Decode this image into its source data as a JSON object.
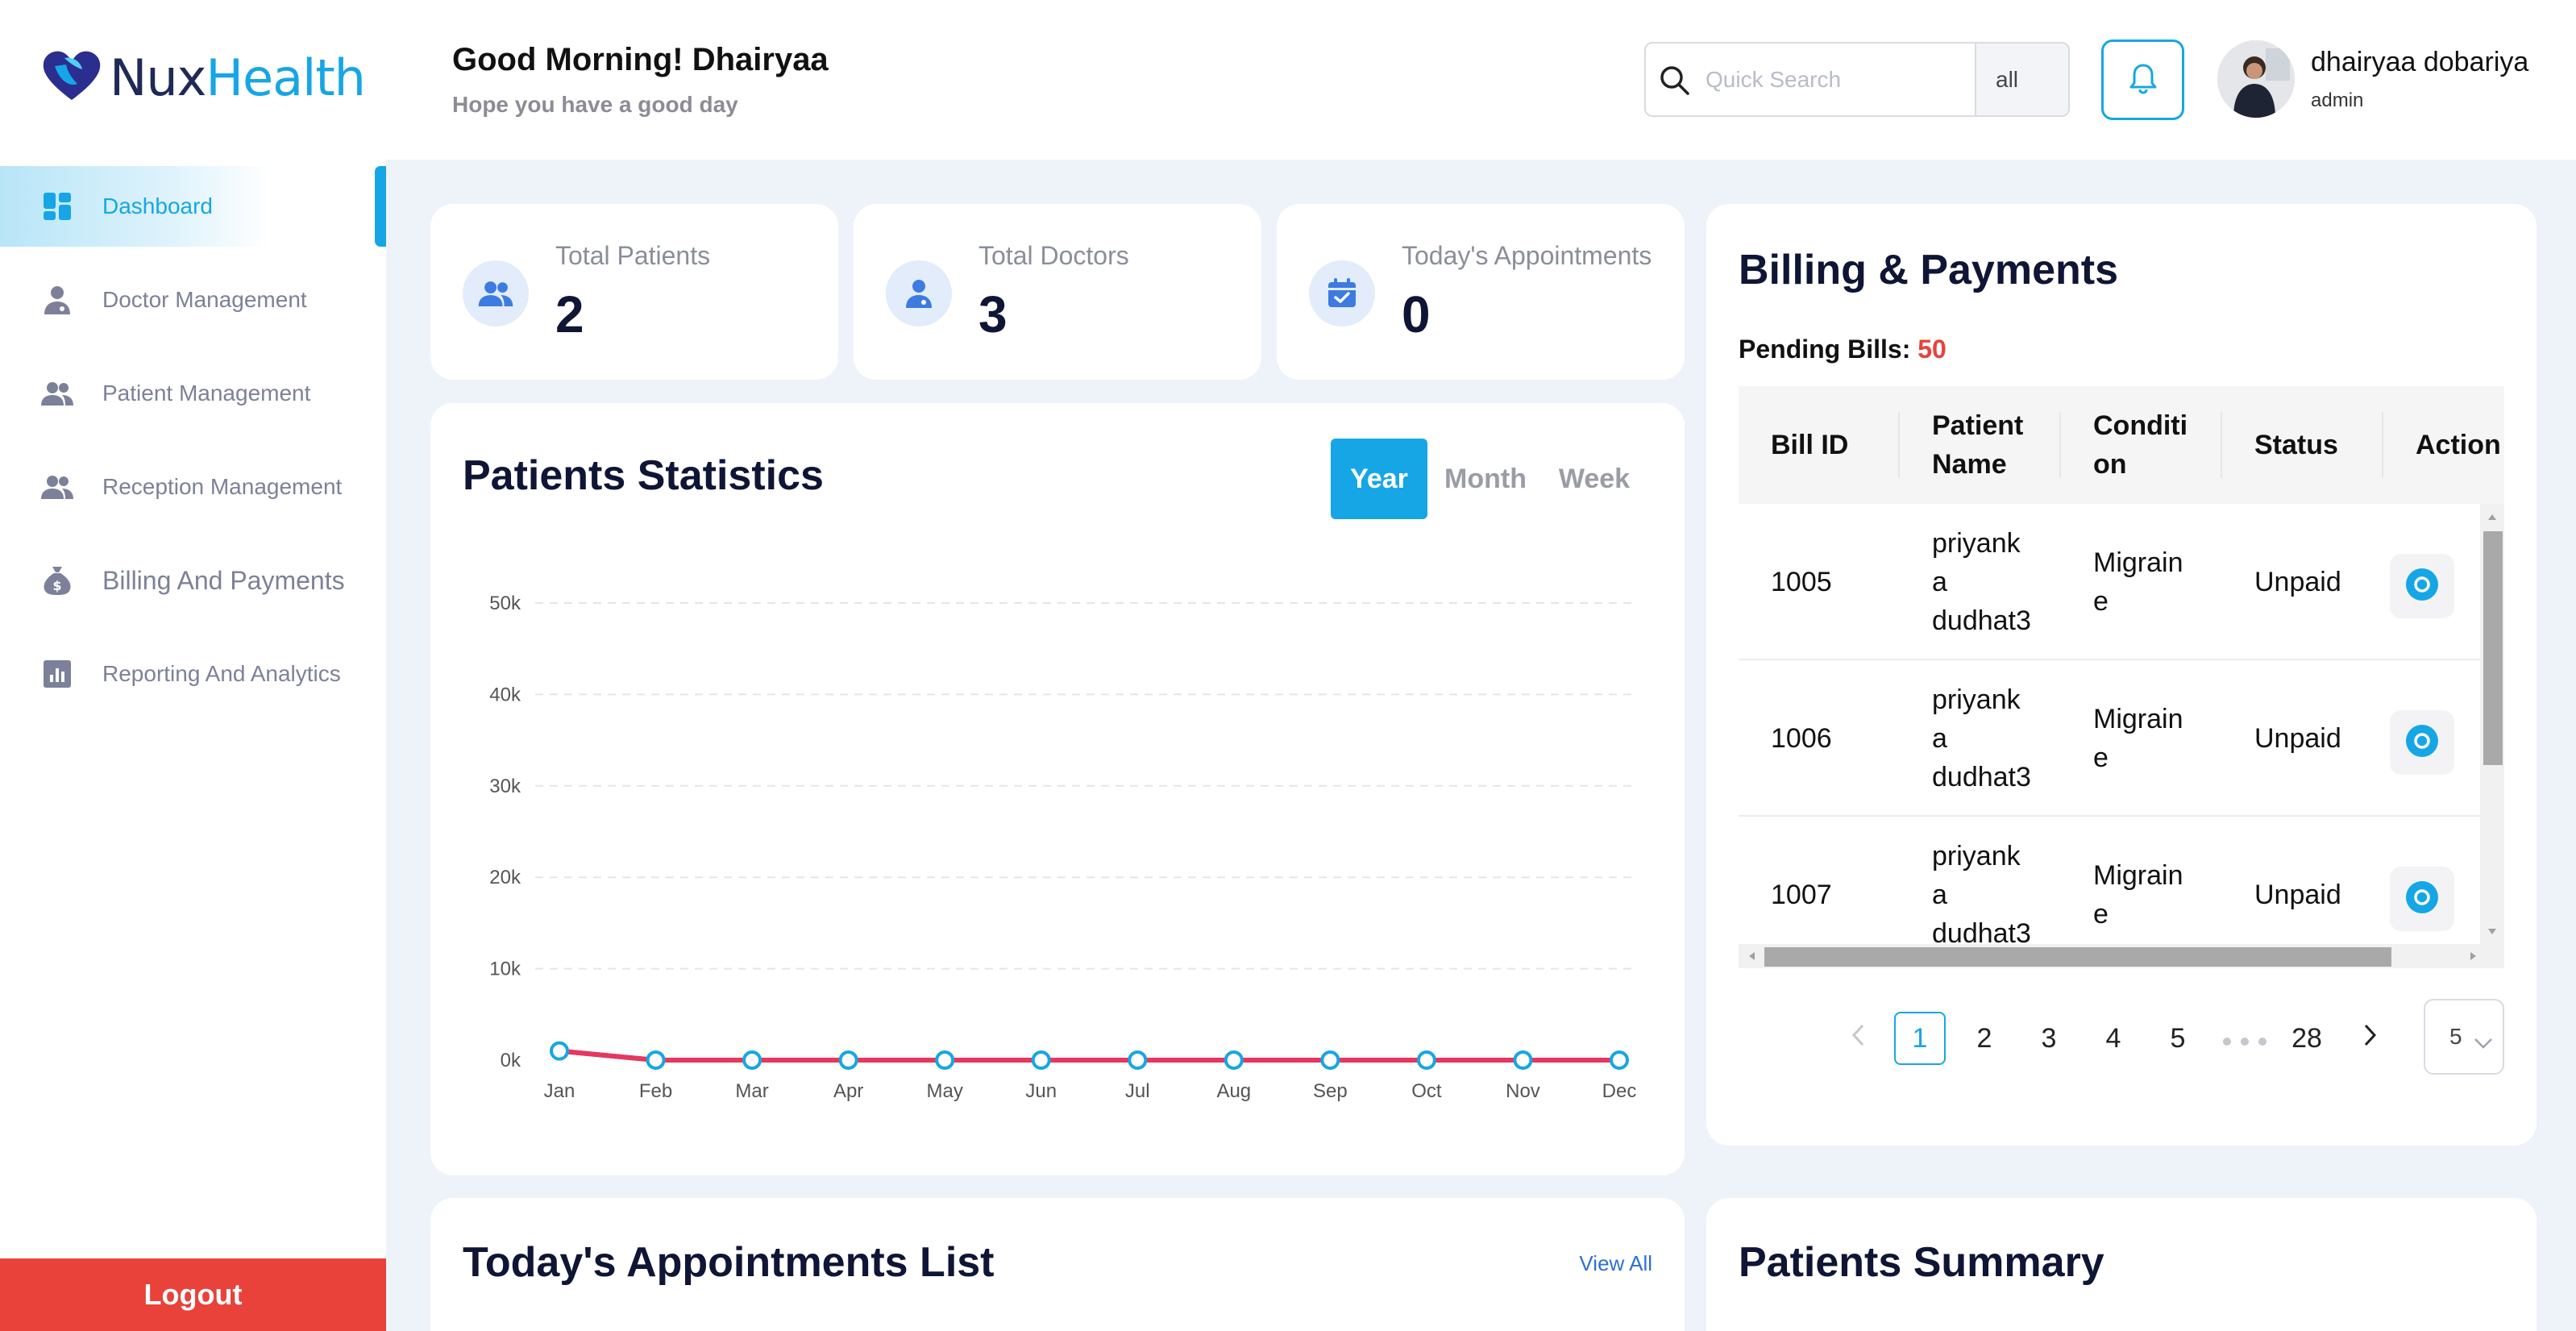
{
  "brand": {
    "part1": "Nux",
    "part2": "Health"
  },
  "sidebar": {
    "items": [
      {
        "label": "Dashboard",
        "icon": "dashboard-icon",
        "active": true
      },
      {
        "label": "Doctor Management",
        "icon": "doctor-icon"
      },
      {
        "label": "Patient Management",
        "icon": "patients-icon"
      },
      {
        "label": "Reception Management",
        "icon": "reception-icon"
      },
      {
        "label": "Billing And Payments",
        "icon": "money-bag-icon"
      },
      {
        "label": "Reporting And Analytics",
        "icon": "analytics-icon"
      }
    ],
    "logout_label": "Logout"
  },
  "header": {
    "greeting": "Good Morning! Dhairyaa",
    "subtitle": "Hope you have a good day",
    "search_placeholder": "Quick Search",
    "search_filter": "all",
    "user_name": "dhairyaa dobariya",
    "user_role": "admin"
  },
  "stats": [
    {
      "label": "Total Patients",
      "value": "2",
      "icon": "patients-icon"
    },
    {
      "label": "Total Doctors",
      "value": "3",
      "icon": "doctor-icon"
    },
    {
      "label": "Today's Appointments",
      "value": "0",
      "icon": "calendar-check-icon"
    }
  ],
  "statistics": {
    "title": "Patients Statistics",
    "periods": [
      "Year",
      "Month",
      "Week"
    ],
    "active_period": "Year"
  },
  "chart_data": {
    "type": "line",
    "categories": [
      "Jan",
      "Feb",
      "Mar",
      "Apr",
      "May",
      "Jun",
      "Jul",
      "Aug",
      "Sep",
      "Oct",
      "Nov",
      "Dec"
    ],
    "series": [
      {
        "values": [
          1000,
          0,
          0,
          0,
          0,
          0,
          0,
          0,
          0,
          0,
          0,
          0
        ],
        "color": "#e8365d"
      },
      {
        "values": [
          1000,
          0,
          0,
          0,
          0,
          0,
          0,
          0,
          0,
          0,
          0,
          0
        ],
        "color": "#4a6fd8"
      }
    ],
    "y_ticks": [
      "0k",
      "10k",
      "20k",
      "30k",
      "40k",
      "50k"
    ],
    "ylim": [
      0,
      50000
    ],
    "grid": true,
    "marker_color": "#16a6e6"
  },
  "billing": {
    "title": "Billing & Payments",
    "pending_label": "Pending Bills:",
    "pending_count": "50",
    "columns": [
      "Bill ID",
      "Patient Name",
      "Conditi on",
      "Status",
      "Action"
    ],
    "rows": [
      {
        "bill_id": "1005",
        "patient": "priyank a dudhat3",
        "condition": "Migrain e",
        "status": "Unpaid"
      },
      {
        "bill_id": "1006",
        "patient": "priyank a dudhat3",
        "condition": "Migrain e",
        "status": "Unpaid"
      },
      {
        "bill_id": "1007",
        "patient": "priyank a dudhat3",
        "condition": "Migrain e",
        "status": "Unpaid"
      }
    ],
    "pagination": {
      "pages": [
        "1",
        "2",
        "3",
        "4",
        "5"
      ],
      "last_page": "28",
      "current": "1",
      "page_size": "5"
    }
  },
  "appointments": {
    "title": "Today's Appointments List",
    "view_all": "View All"
  },
  "summary": {
    "title": "Patients Summary"
  },
  "colors": {
    "accent": "#16a6e6",
    "danger": "#e8423b",
    "navy": "#0f1535"
  }
}
